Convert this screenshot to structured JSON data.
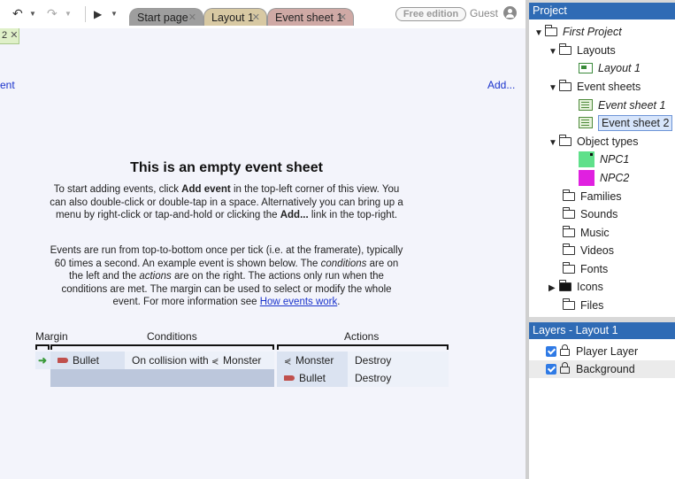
{
  "toolbar": {
    "undo_icon": "undo-icon",
    "redo_icon": "redo-icon",
    "play_icon": "play-icon",
    "free_edition": "Free edition",
    "user": "Guest"
  },
  "tabs": [
    {
      "label": "Start page",
      "color": "#9e9e9e"
    },
    {
      "label": "Layout 1",
      "color": "#d8c9a3"
    },
    {
      "label": "Event sheet 1",
      "color": "#cfa9a5"
    }
  ],
  "subtab": {
    "label": "2"
  },
  "editor": {
    "add_event_partial": "ent",
    "add_link": "Add...",
    "empty_title": "This is an empty event sheet",
    "para1": {
      "t1": "To start adding events, click ",
      "b1": "Add event",
      "t2": " in the top-left corner of this view. You can also double-click or double-tap in a space. Alternatively you can bring up a menu by right-click or tap-and-hold or clicking the ",
      "b2": "Add...",
      "t3": " link in the top-right."
    },
    "para2": {
      "t1": "Events are run from top-to-bottom once per tick (i.e. at the framerate), typically 60 times a second. An example event is shown below. The ",
      "i1": "conditions",
      "t2": " are on the left and the ",
      "i2": "actions",
      "t3": " are on the right. The actions only run when the conditions are met. The margin can be used to select or modify the whole event. For more information see ",
      "link": "How events work",
      "t4": "."
    },
    "example": {
      "headers": {
        "margin": "Margin",
        "conditions": "Conditions",
        "actions": "Actions"
      },
      "condition": {
        "object": "Bullet",
        "text": "On collision with",
        "target": "Monster"
      },
      "actions": [
        {
          "object": "Monster",
          "action": "Destroy"
        },
        {
          "object": "Bullet",
          "action": "Destroy"
        }
      ]
    }
  },
  "project": {
    "title": "Project",
    "root": "First Project",
    "layouts_folder": "Layouts",
    "layout_item": "Layout 1",
    "event_sheets_folder": "Event sheets",
    "event_sheet_1": "Event sheet 1",
    "event_sheet_2": "Event sheet 2",
    "object_types_folder": "Object types",
    "npc1": "NPC1",
    "npc1_color": "#5fe08a",
    "npc2": "NPC2",
    "npc2_color": "#e020e0",
    "families": "Families",
    "sounds": "Sounds",
    "music": "Music",
    "videos": "Videos",
    "fonts": "Fonts",
    "icons": "Icons",
    "files": "Files"
  },
  "layers": {
    "title": "Layers - Layout 1",
    "items": [
      {
        "label": "Player Layer"
      },
      {
        "label": "Background"
      }
    ]
  }
}
